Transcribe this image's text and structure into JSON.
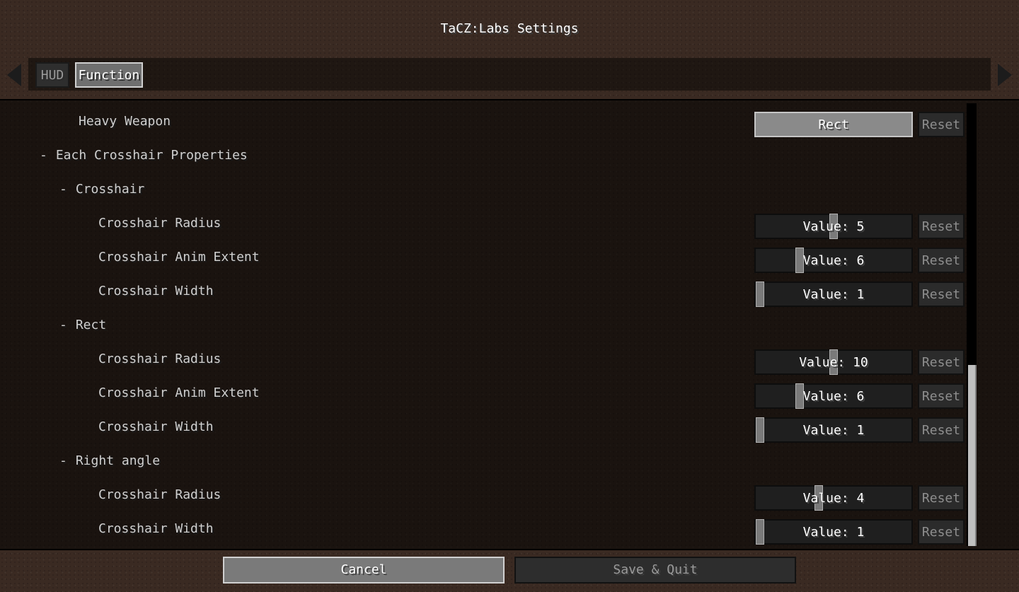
{
  "window": {
    "title": "TaCZ:Labs Settings"
  },
  "tabs": [
    {
      "label": "HUD",
      "active": false
    },
    {
      "label": "Function",
      "active": true
    }
  ],
  "icons": {
    "prev": "chevron-left-icon",
    "next": "chevron-right-icon"
  },
  "rows": [
    {
      "label": "Heavy Weapon",
      "type": "enum",
      "value": "Rect",
      "reset": "Reset"
    },
    {
      "label": "Each Crosshair Properties",
      "type": "group",
      "marker": "-"
    },
    {
      "label": "Crosshair",
      "type": "group",
      "marker": "-"
    },
    {
      "label": "Crosshair Radius",
      "type": "slider",
      "value": "Value: 5",
      "reset": "Reset",
      "level": 0.5
    },
    {
      "label": "Crosshair Anim Extent",
      "type": "slider",
      "value": "Value: 6",
      "reset": "Reset",
      "level": 0.27
    },
    {
      "label": "Crosshair Width",
      "type": "slider",
      "value": "Value: 1",
      "reset": "Reset",
      "level": 0.0
    },
    {
      "label": "Rect",
      "type": "group",
      "marker": "-"
    },
    {
      "label": "Crosshair Radius",
      "type": "slider",
      "value": "Value: 10",
      "reset": "Reset",
      "level": 0.5
    },
    {
      "label": "Crosshair Anim Extent",
      "type": "slider",
      "value": "Value: 6",
      "reset": "Reset",
      "level": 0.27
    },
    {
      "label": "Crosshair Width",
      "type": "slider",
      "value": "Value: 1",
      "reset": "Reset",
      "level": 0.0
    },
    {
      "label": "Right angle",
      "type": "group",
      "marker": "-"
    },
    {
      "label": "Crosshair Radius",
      "type": "slider",
      "value": "Value: 4",
      "reset": "Reset",
      "level": 0.4
    },
    {
      "label": "Crosshair Width",
      "type": "slider",
      "value": "Value: 1",
      "reset": "Reset",
      "level": 0.0
    }
  ],
  "footer": {
    "cancel_label": "Cancel",
    "save_label": "Save & Quit"
  }
}
